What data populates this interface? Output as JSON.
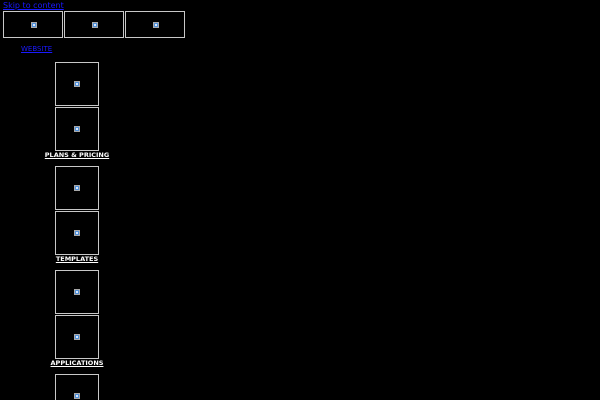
{
  "skip_link": "Skip to content",
  "website_link": "WEBSITE",
  "thumb_icon": "broken-image-icon",
  "thumbnails_top": [
    {
      "icon": "broken-image-icon"
    },
    {
      "icon": "broken-image-icon"
    },
    {
      "icon": "broken-image-icon"
    }
  ],
  "sections": [
    {
      "label": "PLANS & PRICING"
    },
    {
      "label": "TEMPLATES"
    },
    {
      "label": "APPLICATIONS"
    }
  ],
  "colors": {
    "background": "#000000",
    "link": "#1a1aff",
    "frame_border": "#c8c8c8",
    "label": "#ffffff",
    "icon": "#4f8fd8"
  }
}
